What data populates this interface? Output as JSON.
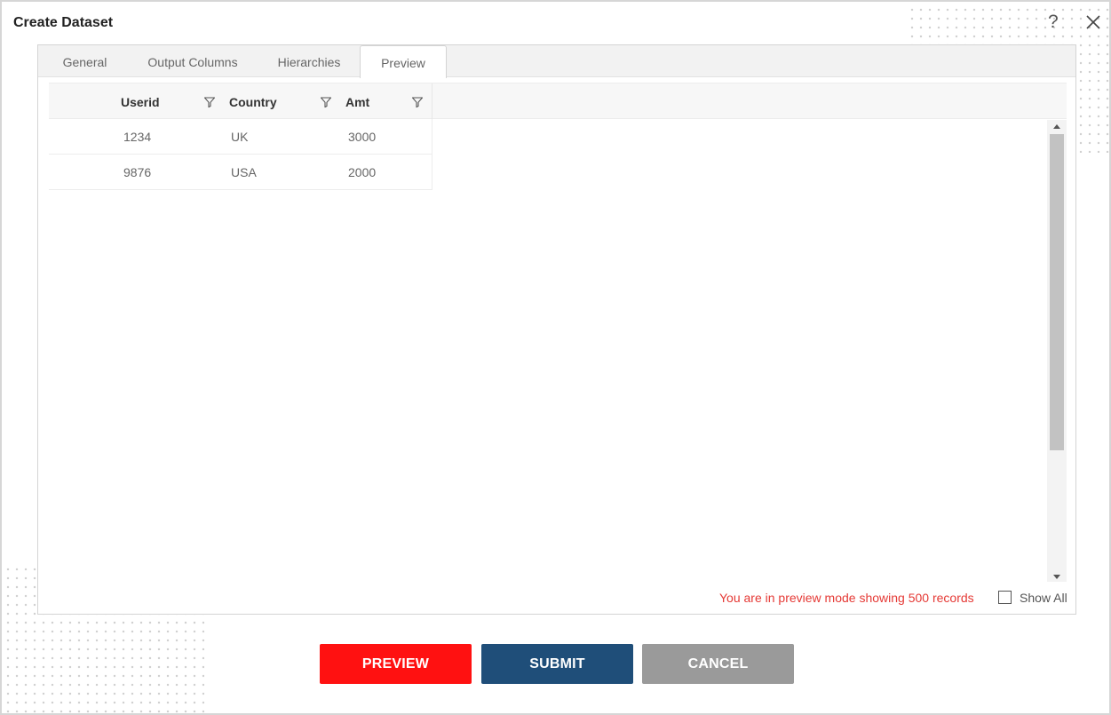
{
  "dialog": {
    "title": "Create Dataset",
    "help_symbol": "?"
  },
  "tabs": [
    {
      "label": "General",
      "active": false
    },
    {
      "label": "Output Columns",
      "active": false
    },
    {
      "label": "Hierarchies",
      "active": false
    },
    {
      "label": "Preview",
      "active": true
    }
  ],
  "grid": {
    "columns": [
      "Userid",
      "Country",
      "Amt"
    ],
    "rows": [
      [
        "1234",
        "UK",
        "3000"
      ],
      [
        "9876",
        "USA",
        "2000"
      ]
    ]
  },
  "footer": {
    "preview_message": "You are in preview mode showing 500 records",
    "show_all_label": "Show All",
    "show_all_checked": false
  },
  "buttons": {
    "preview": "PREVIEW",
    "submit": "SUBMIT",
    "cancel": "CANCEL"
  },
  "colors": {
    "preview_button": "#ff1111",
    "submit_button": "#1f4e79",
    "cancel_button": "#9a9a9a",
    "message": "#e53935"
  },
  "icons": [
    "help-icon",
    "close-icon",
    "filter-icon"
  ]
}
